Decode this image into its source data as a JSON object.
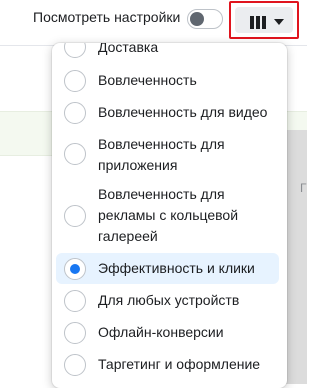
{
  "toolbar": {
    "view_settings_label": "Посмотреть настройки",
    "view_settings_toggle_on": false,
    "columns_button_icon": "columns-icon",
    "dropdown_icon": "chevron-down-icon"
  },
  "background": {
    "truncated_text": "Г"
  },
  "menu": {
    "items": [
      {
        "label": "Доставка",
        "selected": false
      },
      {
        "label": "Вовлеченность",
        "selected": false
      },
      {
        "label": "Вовлеченность для видео",
        "selected": false
      },
      {
        "label": "Вовлеченность для приложения",
        "selected": false
      },
      {
        "label": "Вовлеченность для рекламы с кольцевой галереей",
        "selected": false
      },
      {
        "label": "Эффективность и клики",
        "selected": true
      },
      {
        "label": "Для любых устройств",
        "selected": false
      },
      {
        "label": "Офлайн-конверсии",
        "selected": false
      },
      {
        "label": "Таргетинг и оформление",
        "selected": false
      }
    ]
  },
  "colors": {
    "accent": "#1877f2",
    "selected_bg": "#e7f3ff",
    "highlight_border": "#e0141e"
  }
}
